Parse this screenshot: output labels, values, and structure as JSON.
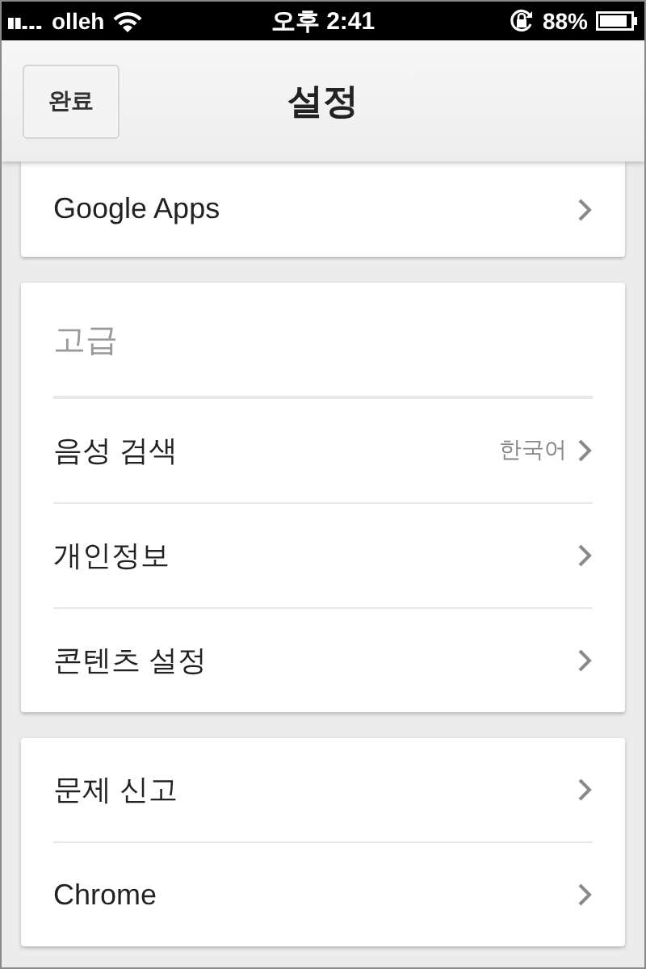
{
  "status_bar": {
    "carrier": "olleh",
    "time": "오후 2:41",
    "battery_text": "88%"
  },
  "nav_bar": {
    "done_button": "완료",
    "title": "설정"
  },
  "sections": [
    {
      "items": [
        {
          "label": "Google Apps"
        }
      ]
    },
    {
      "header": "고급",
      "items": [
        {
          "label": "음성 검색",
          "value": "한국어"
        },
        {
          "label": "개인정보"
        },
        {
          "label": "콘텐츠 설정"
        }
      ]
    },
    {
      "items": [
        {
          "label": "문제 신고"
        },
        {
          "label": "Chrome"
        }
      ]
    }
  ]
}
